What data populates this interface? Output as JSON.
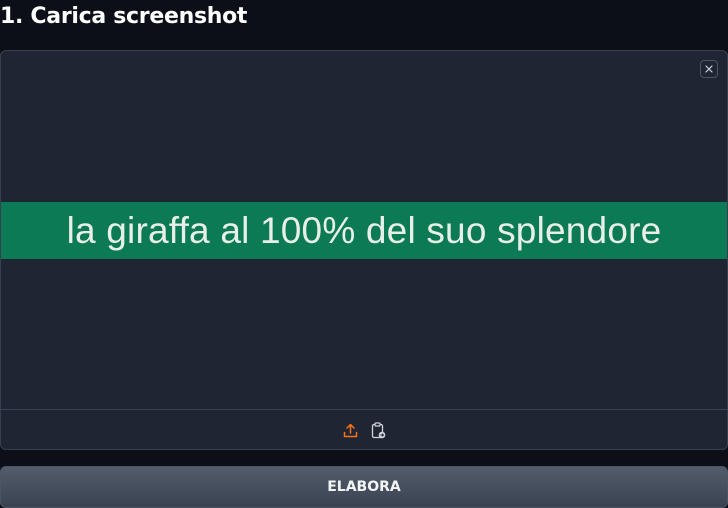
{
  "header": {
    "title": "1. Carica screenshot"
  },
  "upload": {
    "preview_text": "la giraffa al 100% del suo splendore",
    "close_icon": "close-icon",
    "upload_icon": "upload-icon",
    "paste_icon": "clipboard-paste-icon"
  },
  "actions": {
    "process_label": "ELABORA"
  },
  "colors": {
    "background": "#0c0f17",
    "panel": "#1f2533",
    "preview_strip": "#0b7a55",
    "accent_upload_icon": "#f97316"
  }
}
